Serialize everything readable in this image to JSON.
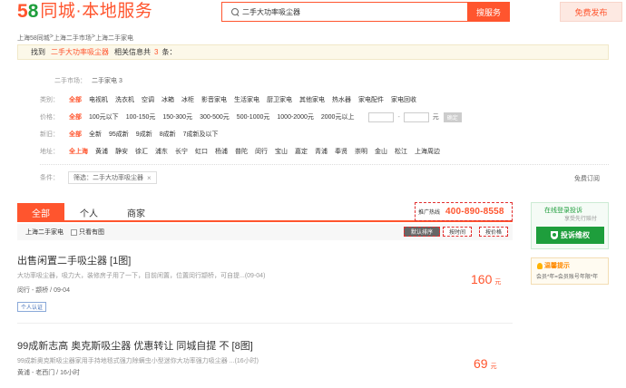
{
  "header": {
    "logo_num_5": "5",
    "logo_num_8": "8",
    "logo_text": "同城·本地服务",
    "search_value": "二手大功率吸尘器",
    "search_button": "搜服务",
    "post_button": "免费发布"
  },
  "breadcrumb": [
    "上海58同城",
    " > ",
    "上海二手市场",
    " > ",
    "上海二手家电"
  ],
  "found": {
    "prefix": "找到",
    "keyword": "二手大功率吸尘器",
    "middle": "相关信息共",
    "count": "3",
    "suffix": "条："
  },
  "market": {
    "label": "二手市场：",
    "value": "二手家电 3"
  },
  "filters": {
    "category": {
      "label": "类别：",
      "options": [
        "全部",
        "电视机",
        "洗衣机",
        "空调",
        "冰箱",
        "冰柜",
        "影音家电",
        "生活家电",
        "厨卫家电",
        "其他家电",
        "热水器",
        "家电配件",
        "家电回收"
      ]
    },
    "price": {
      "label": "价格：",
      "options": [
        "全部",
        "100元以下",
        "100-150元",
        "150-300元",
        "300-500元",
        "500-1000元",
        "1000-2000元",
        "2000元以上"
      ],
      "sep": "-",
      "unit": "元",
      "ok": "确定"
    },
    "condition": {
      "label": "新旧：",
      "options": [
        "全部",
        "全新",
        "95成新",
        "9成新",
        "8成新",
        "7成新及以下"
      ]
    },
    "area": {
      "label": "地址：",
      "options": [
        "全上海",
        "黄浦",
        "静安",
        "徐汇",
        "浦东",
        "长宁",
        "虹口",
        "杨浦",
        "普陀",
        "闵行",
        "宝山",
        "嘉定",
        "青浦",
        "奉贤",
        "崇明",
        "金山",
        "松江",
        "上海周边"
      ]
    }
  },
  "conditions": {
    "label": "条件：",
    "chip": "筛选：二手大功率吸尘器",
    "chip_close": "×",
    "cancel_subscribe": "免费订阅"
  },
  "tabs": [
    "全部",
    "个人",
    "商家"
  ],
  "hotline": {
    "label": "推广热线",
    "number": "400-890-8558"
  },
  "subbar": {
    "category": "上海二手家电",
    "has_image": "只看有图",
    "sort_default": "默认排序",
    "sort_time": "按时间",
    "sort_price": "按价格"
  },
  "listings": [
    {
      "title": "出售闲置二手吸尘器 [1图]",
      "desc": "大功率吸尘器，吸力大，装修房子用了一下，目前闲置，位置闵行颛桥，可自提...(09-04)",
      "location": "闵行 - 颛桥",
      "date": " / 09-04",
      "price": "160",
      "unit": "元",
      "badge": "个人认证"
    },
    {
      "title": "99成新志高 奥克斯吸尘器 优惠转让 同城自提 不 [8图]",
      "desc": "99成新奥克斯吸尘器家用手持地毯式强力除螨虫小型迷你大功率强力吸尘器 ...(16小时)",
      "location": "黄浦 - 老西门",
      "date": " / 16小时",
      "price": "69",
      "unit": "元"
    }
  ],
  "right_panel": {
    "login_title": "在线登录投诉",
    "login_sub": "享受先行赔付",
    "complain_button": "投诉维权",
    "tip_title": "温馨提示",
    "tip_text": "会员*年=会员账号年限*年"
  },
  "colors": {
    "accent": "#ff552e",
    "green": "#1e9e3c"
  }
}
